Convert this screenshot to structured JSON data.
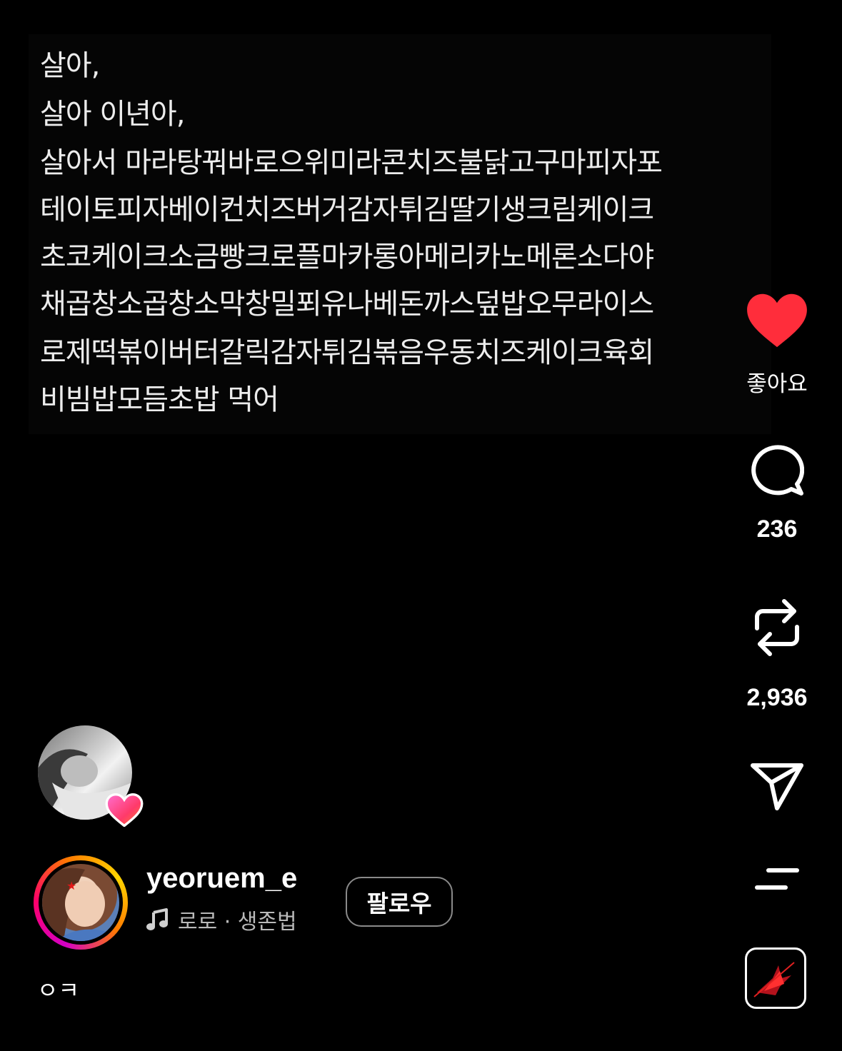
{
  "post": {
    "lines": [
      "살아,",
      "살아 이년아,",
      "살아서 마라탕꿔바로으위미라콘치즈불닭고구마피자포",
      "테이토피자베이컨치즈버거감자튀김딸기생크림케이크",
      "초코케이크소금빵크로플마카롱아메리카노메론소다야",
      "채곱창소곱창소막창밀푀유나베돈까스덮밥오무라이스",
      "로제떡볶이버터갈릭감자튀김볶음우동치즈케이크육회",
      "비빔밥모듬초밥 먹어"
    ]
  },
  "actions": {
    "like_label": "좋아요",
    "comment_count": "236",
    "repost_count": "2,936"
  },
  "author": {
    "username": "yeoruem_e",
    "follow_label": "팔로우",
    "music": "로로 · 생존법"
  },
  "caption": "ㅇㅋ",
  "colors": {
    "like": "#ff2d3b",
    "background": "#000000",
    "text": "#ffffff"
  },
  "icons": [
    "heart-icon",
    "comment-icon",
    "repost-icon",
    "share-icon",
    "more-icon",
    "music-note-icon",
    "audio-thumbnail"
  ]
}
